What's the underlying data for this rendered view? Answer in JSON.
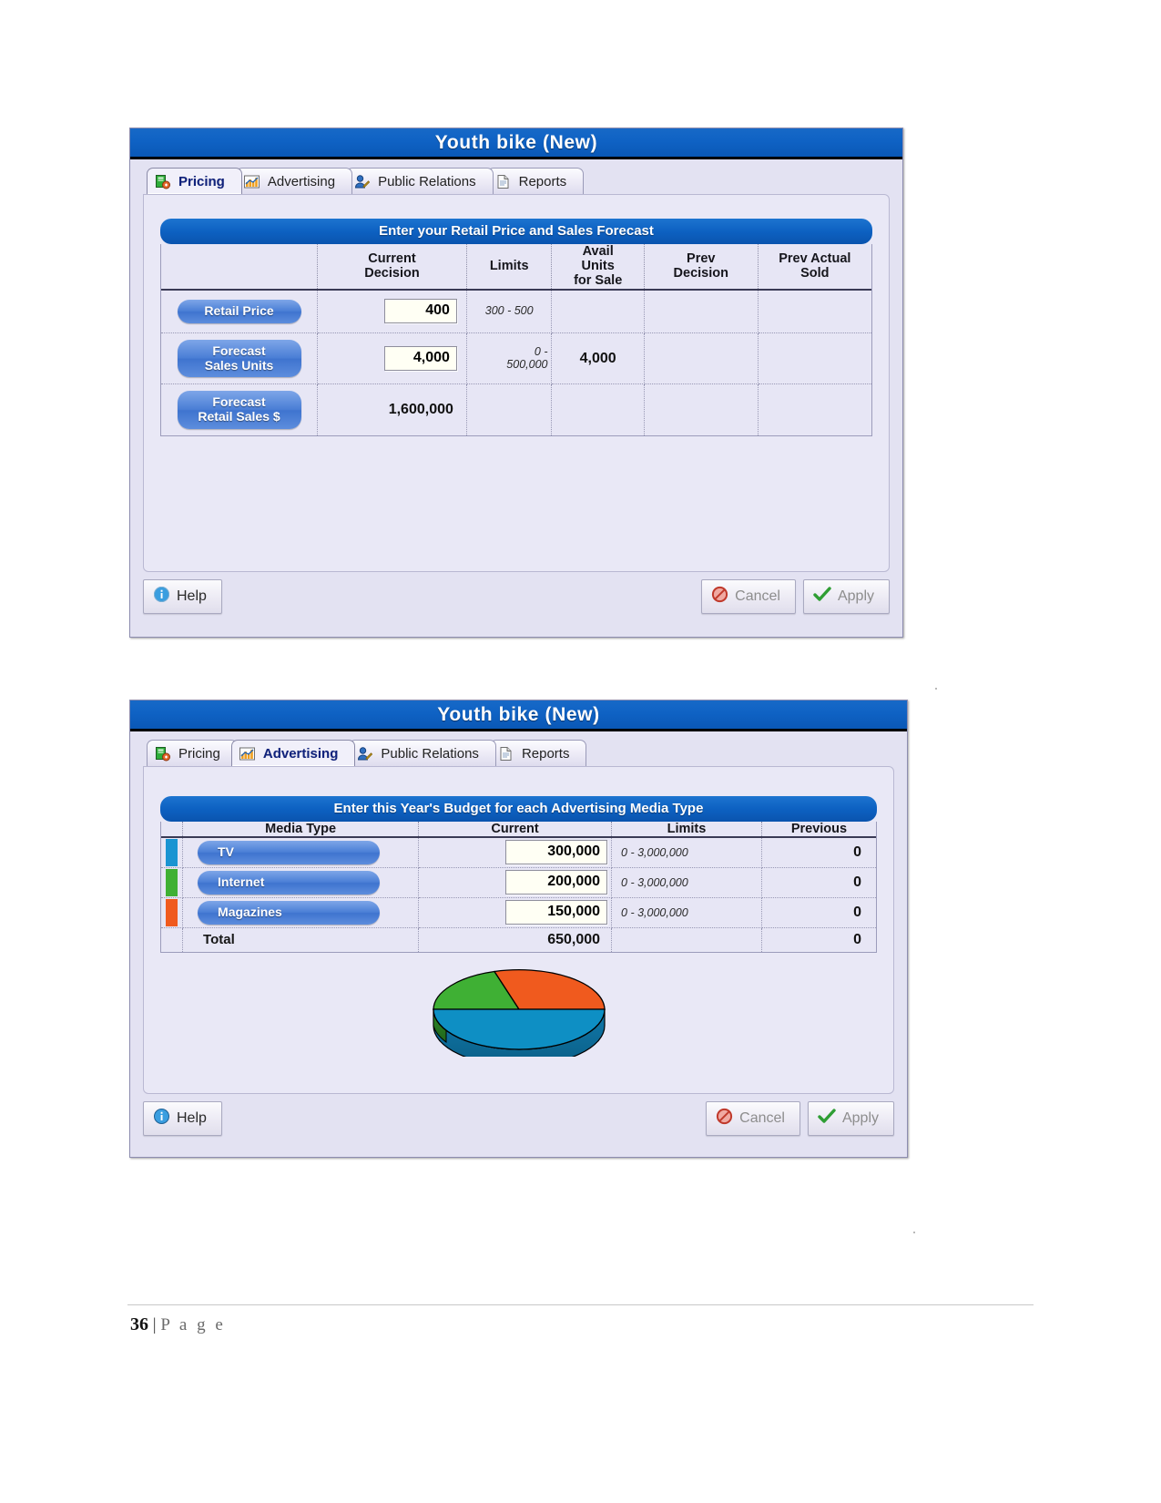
{
  "document": {
    "footer_page_number": "36",
    "footer_page_word": "P a g e",
    "footer_separator": "|"
  },
  "dialog_pricing": {
    "title": "Youth bike (New)",
    "tabs": [
      {
        "label": "Pricing",
        "icon": "pricing-tag-icon",
        "active": true
      },
      {
        "label": "Advertising",
        "icon": "chart-bar-icon",
        "active": false
      },
      {
        "label": "Public Relations",
        "icon": "person-pencil-icon",
        "active": false
      },
      {
        "label": "Reports",
        "icon": "document-icon",
        "active": false
      }
    ],
    "section_header": "Enter your Retail Price and Sales Forecast",
    "columns": [
      "",
      "Current Decision",
      "Limits",
      "Avail Units for Sale",
      "Prev Decision",
      "Prev Actual Sold"
    ],
    "column_lines": [
      [
        "",
        ""
      ],
      [
        "Current",
        "Decision"
      ],
      [
        "Limits",
        ""
      ],
      [
        "Avail",
        "Units",
        "for Sale"
      ],
      [
        "Prev",
        "Decision"
      ],
      [
        "Prev Actual",
        "Sold"
      ]
    ],
    "rows": [
      {
        "label": "Retail Price",
        "current": "400",
        "current_is_input": true,
        "limits": "300 - 500",
        "limits_lines": [
          "300 - 500"
        ],
        "avail": "",
        "prev_decision": "",
        "prev_actual": ""
      },
      {
        "label": "Forecast Sales Units",
        "label_lines": [
          "Forecast",
          "Sales Units"
        ],
        "current": "4,000",
        "current_is_input": true,
        "limits": "0 - 500,000",
        "limits_lines": [
          "0 -",
          "500,000"
        ],
        "avail": "4,000",
        "prev_decision": "",
        "prev_actual": ""
      },
      {
        "label": "Forecast Retail Sales $",
        "label_lines": [
          "Forecast",
          "Retail Sales $"
        ],
        "current": "1,600,000",
        "current_is_input": false,
        "limits": "",
        "limits_lines": [],
        "avail": "",
        "prev_decision": "",
        "prev_actual": ""
      }
    ],
    "buttons": {
      "help": "Help",
      "cancel": "Cancel",
      "apply": "Apply"
    }
  },
  "dialog_advertising": {
    "title": "Youth bike (New)",
    "tabs": [
      {
        "label": "Pricing",
        "icon": "pricing-tag-icon",
        "active": false
      },
      {
        "label": "Advertising",
        "icon": "chart-bar-icon",
        "active": true
      },
      {
        "label": "Public Relations",
        "icon": "person-pencil-icon",
        "active": false
      },
      {
        "label": "Reports",
        "icon": "document-icon",
        "active": false
      }
    ],
    "section_header": "Enter this Year's Budget for each Advertising Media Type",
    "columns": [
      "",
      "Media Type",
      "Current",
      "Limits",
      "Previous"
    ],
    "rows": [
      {
        "label": "TV",
        "swatch_color": "#1a94d2",
        "current": "300,000",
        "limits": "0 - 3,000,000",
        "previous": "0"
      },
      {
        "label": "Internet",
        "swatch_color": "#3fb034",
        "current": "200,000",
        "limits": "0 - 3,000,000",
        "previous": "0"
      },
      {
        "label": "Magazines",
        "swatch_color": "#f05a1e",
        "current": "150,000",
        "limits": "0 - 3,000,000",
        "previous": "0"
      }
    ],
    "total_row": {
      "label": "Total",
      "current": "650,000",
      "limits": "",
      "previous": "0"
    },
    "buttons": {
      "help": "Help",
      "cancel": "Cancel",
      "apply": "Apply"
    },
    "chart_data": {
      "type": "pie",
      "title": "",
      "categories": [
        "TV",
        "Internet",
        "Magazines"
      ],
      "values": [
        300000,
        200000,
        150000
      ],
      "percentages": [
        46.2,
        30.8,
        23.1
      ],
      "colors": [
        "#1a94d2",
        "#3fb034",
        "#f05a1e"
      ],
      "legend_position": "none",
      "style": "3d-pie"
    }
  }
}
